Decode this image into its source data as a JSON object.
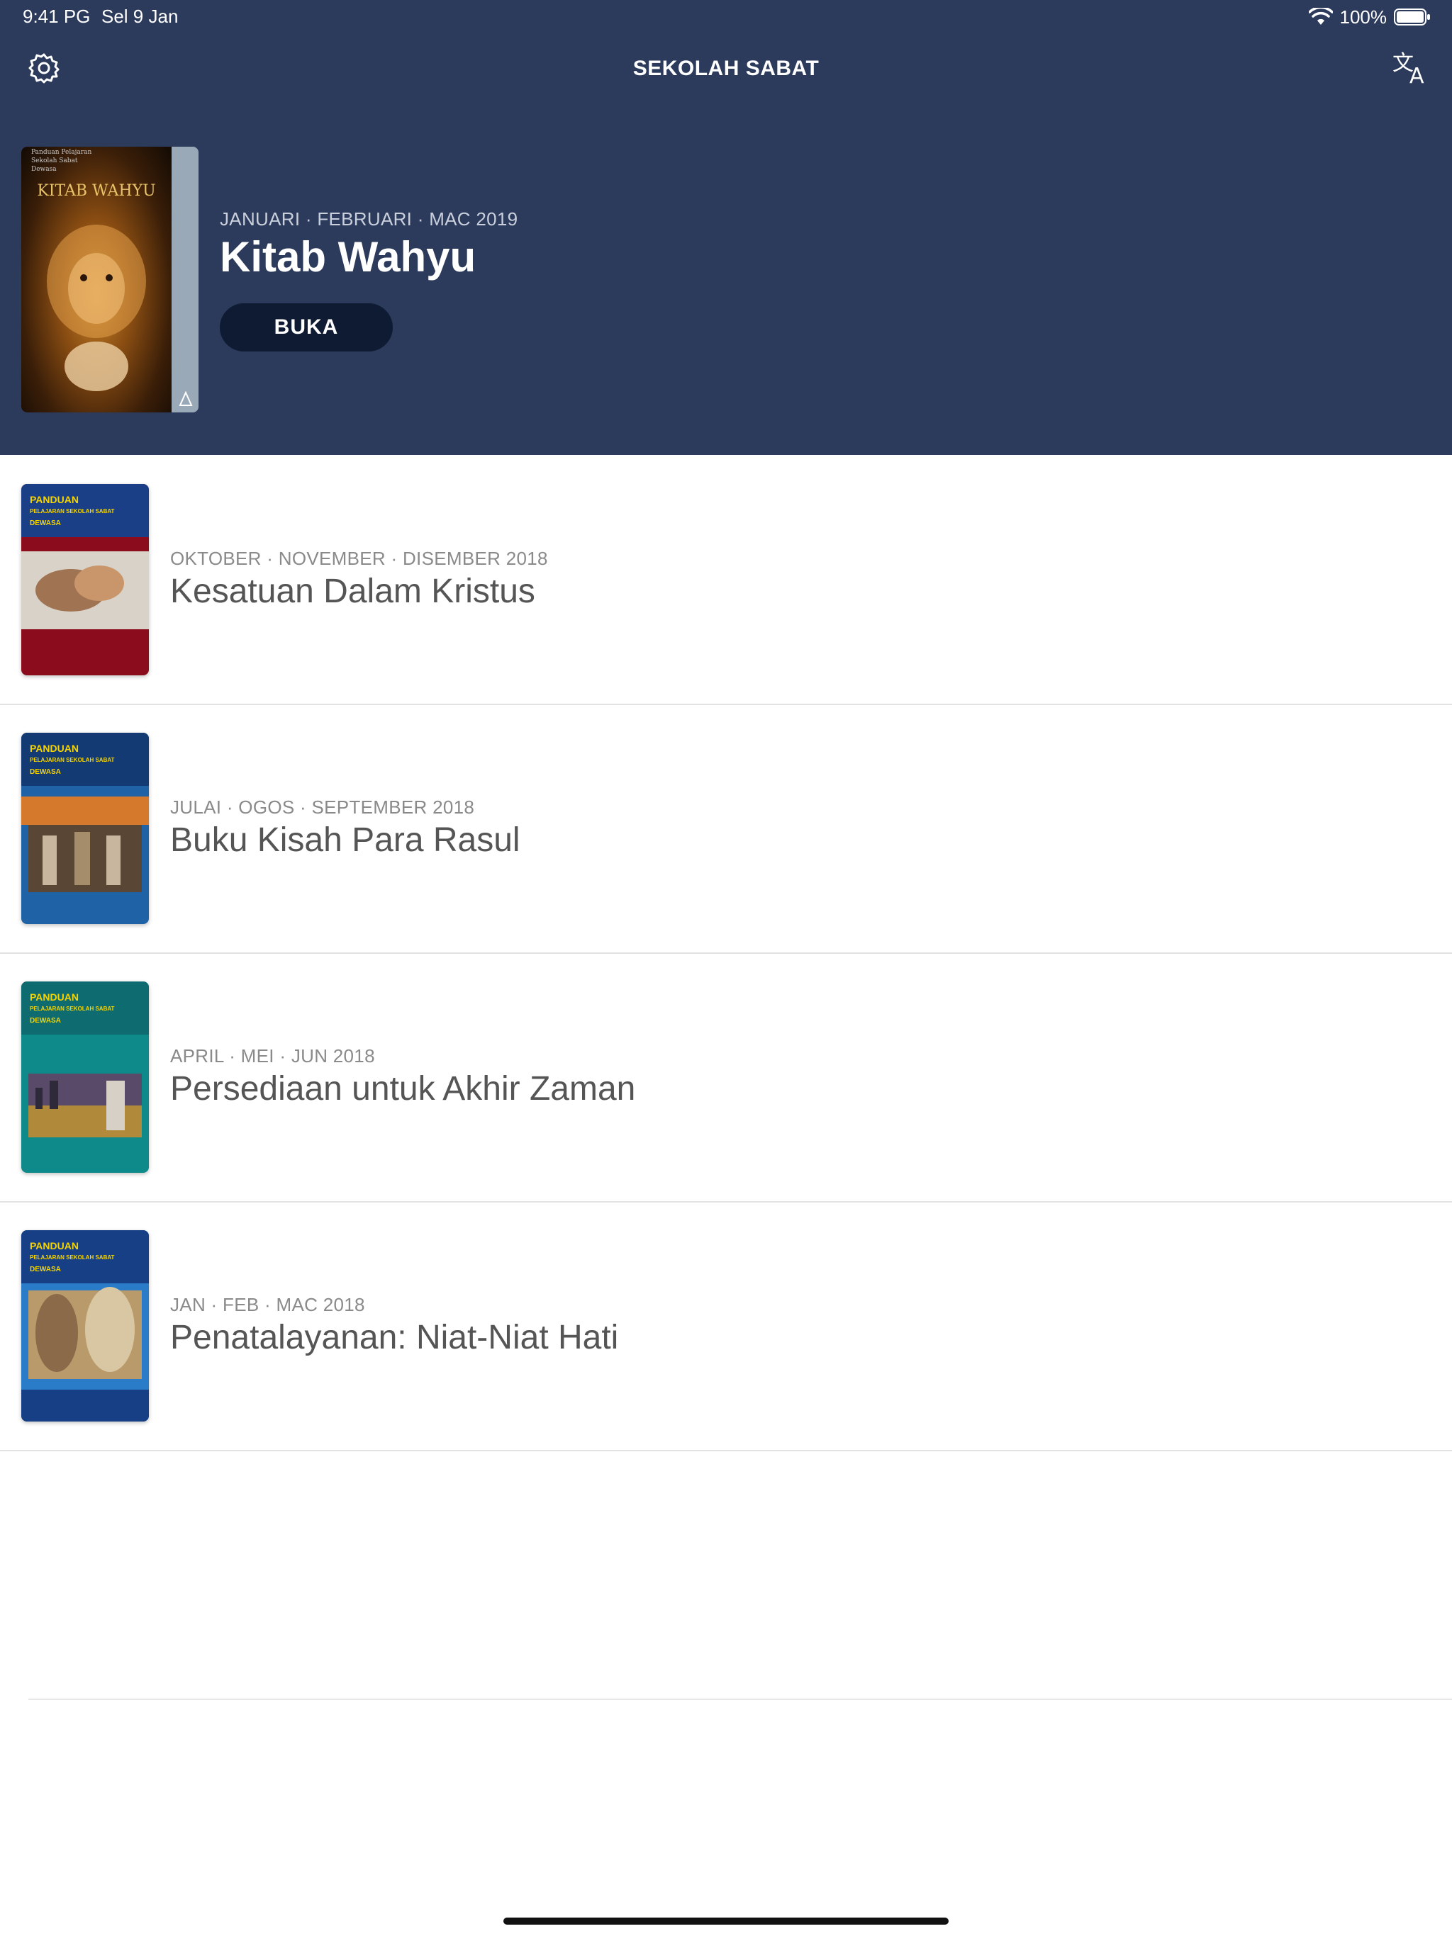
{
  "status_bar": {
    "time": "9:41 PG",
    "date": "Sel 9 Jan",
    "battery_text": "100%"
  },
  "nav": {
    "title": "SEKOLAH SABAT",
    "settings_icon": "gear-icon",
    "language_icon": "translate-icon"
  },
  "featured": {
    "cover_title": "KITAB WAHYU",
    "cover_toptext": "Panduan Pelajaran\nSekolah Sabat\nDewasa",
    "dates": "JANUARI · FEBRUARI · MAC 2019",
    "title": "Kitab Wahyu",
    "open_label": "BUKA"
  },
  "lessons": [
    {
      "dates": "OKTOBER · NOVEMBER · DISEMBER 2018",
      "title": "Kesatuan Dalam Kristus",
      "cover": {
        "label": "PANDUAN",
        "sub": "PELAJARAN SEKOLAH SABAT",
        "sub2": "DEWASA",
        "band": "#1a3f86",
        "body": "#8b0d1d"
      }
    },
    {
      "dates": "JULAI · OGOS · SEPTEMBER 2018",
      "title": "Buku Kisah Para Rasul",
      "cover": {
        "label": "PANDUAN",
        "sub": "PELAJARAN SEKOLAH SABAT",
        "sub2": "DEWASA",
        "band": "#143a74",
        "body": "#1f63a6"
      }
    },
    {
      "dates": "APRIL · MEI · JUN 2018",
      "title": "Persediaan untuk Akhir Zaman",
      "cover": {
        "label": "PANDUAN",
        "sub": "PELAJARAN SEKOLAH SABAT",
        "sub2": "DEWASA",
        "band": "#0e6b70",
        "body": "#0f8a8a"
      }
    },
    {
      "dates": "JAN · FEB · MAC 2018",
      "title": "Penatalayanan: Niat-Niat Hati",
      "cover": {
        "label": "PANDUAN",
        "sub": "PELAJARAN SEKOLAH SABAT",
        "sub2": "DEWASA",
        "band": "#163f86",
        "body": "#2a7bc8"
      }
    }
  ]
}
